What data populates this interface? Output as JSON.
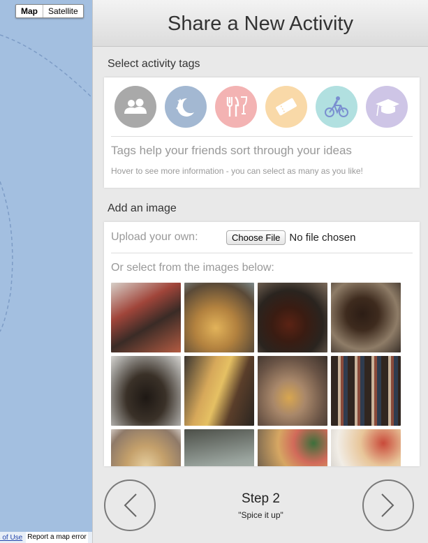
{
  "map": {
    "toggle": {
      "map_label": "Map",
      "satellite_label": "Satellite"
    },
    "footer": {
      "terms_label": "ns of Use",
      "report_label": "Report a map error"
    }
  },
  "panel": {
    "title": "Share a New Activity",
    "tags_section": {
      "label": "Select activity tags",
      "tags": [
        {
          "icon": "people-icon",
          "color": "#a9a9a9"
        },
        {
          "icon": "moon-stars-icon",
          "color": "#a3b8d2"
        },
        {
          "icon": "fork-knife-glass-icon",
          "color": "#f3b3b3"
        },
        {
          "icon": "ticket-icon",
          "color": "#f9d9a8"
        },
        {
          "icon": "cyclist-icon",
          "color": "#b1e0e0"
        },
        {
          "icon": "graduation-cap-icon",
          "color": "#cec5e6"
        }
      ],
      "hint": "Tags help your friends sort through your ideas",
      "subhint": "Hover to see more information - you can select as many as you like!"
    },
    "image_section": {
      "label": "Add an image",
      "upload_label": "Upload your own:",
      "choose_file_label": "Choose File",
      "file_status": "No file chosen",
      "select_label": "Or select from the images below:"
    },
    "footer": {
      "step_title": "Step 2",
      "step_subtitle": "\"Spice it up\""
    }
  }
}
